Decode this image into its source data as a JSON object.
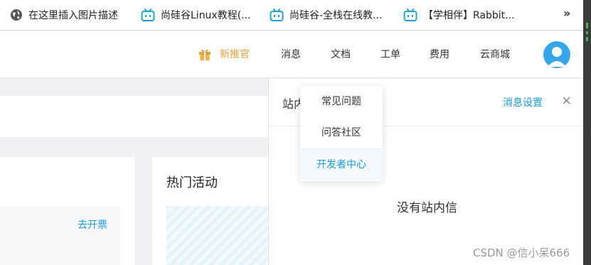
{
  "bookmarks": {
    "items": [
      {
        "label": "在这里插入图片描述",
        "icon": "globe-icon"
      },
      {
        "label": "尚硅谷Linux教程(...",
        "icon": "bilibili-icon"
      },
      {
        "label": "尚硅谷-全栈在线教...",
        "icon": "bilibili-icon"
      },
      {
        "label": "【学相伴】Rabbit...",
        "icon": "bilibili-icon"
      }
    ],
    "more": "»"
  },
  "topnav": {
    "new_promo": "新推官",
    "messages": "消息",
    "docs": "文档",
    "tickets": "工单",
    "billing": "费用",
    "cloud_market": "云商城"
  },
  "dropdown": {
    "items": [
      "常见问题",
      "问答社区",
      "开发者中心"
    ],
    "active_index": 2
  },
  "drawer": {
    "title": "站内",
    "settings": "消息设置",
    "close": "×",
    "empty_text": "没有站内信"
  },
  "content": {
    "invoice_link": "去开票",
    "hot_events_title": "热门活动"
  },
  "watermark": "CSDN @信小呆666",
  "colors": {
    "accent": "#1a9bd7",
    "promo": "#e6a23c",
    "avatar": "#35a7e8"
  }
}
